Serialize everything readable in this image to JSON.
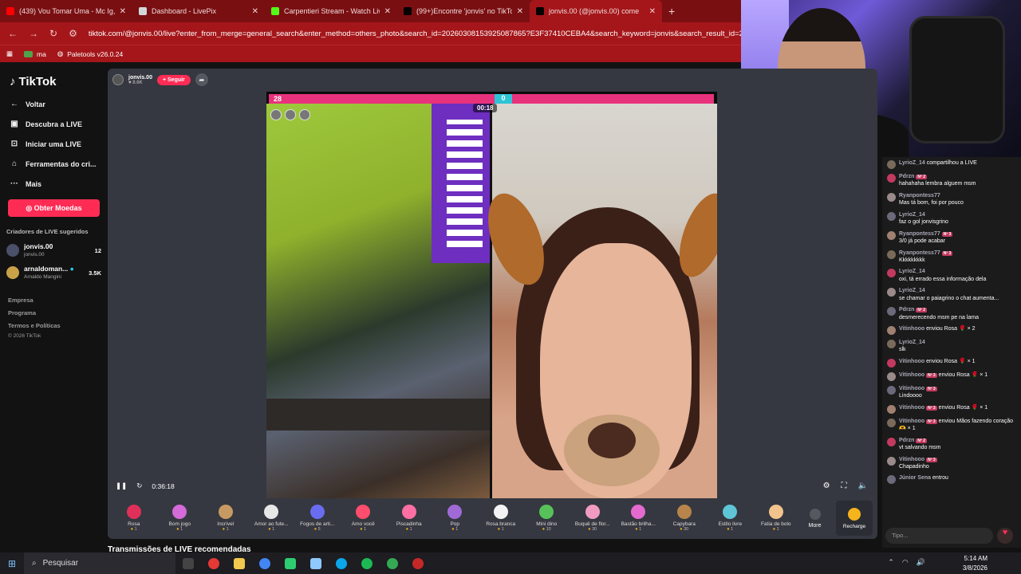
{
  "tabs": [
    {
      "title": "(439) Vou Tomar Uma - Mc Ig, M",
      "fav": "#ff0000"
    },
    {
      "title": "Dashboard - LivePix",
      "fav": "#cfd8dc"
    },
    {
      "title": "Carpentieri Stream - Watch Live",
      "fav": "#53fc18"
    },
    {
      "title": "(99+)Encontre 'jonvis' no TikTok",
      "fav": "#000000"
    },
    {
      "title": "jonvis.00 (@jonvis.00) come",
      "fav": "#000000"
    }
  ],
  "address": {
    "url": "tiktok.com/@jonvis.00/live?enter_from_merge=general_search&enter_method=others_photo&search_id=20260308153925087865?E3F37410CEBA4&search_keyword=jonvis&search_result_id=2422438"
  },
  "bookmarks": [
    "ma",
    "Paletools v26.0.24"
  ],
  "sidebar": {
    "logo": "TikTok",
    "items": [
      {
        "icon": "←",
        "label": "Voltar"
      },
      {
        "icon": "▣",
        "label": "Descubra a LIVE"
      },
      {
        "icon": "⊡",
        "label": "Iniciar uma LIVE"
      },
      {
        "icon": "⌂",
        "label": "Ferramentas do cri..."
      },
      {
        "icon": "···",
        "label": "Mais"
      }
    ],
    "coins": "Obter Moedas",
    "suggested_title": "Criadores de LIVE sugeridos",
    "creators": [
      {
        "name": "jonvis.00",
        "sub": "jonvis.00",
        "count": "12"
      },
      {
        "name": "arnaldoman...",
        "sub": "Arnaldo Mangini",
        "count": "3.5K"
      }
    ],
    "footer": [
      "Empresa",
      "Programa",
      "Termos e Políticas"
    ],
    "copyright": "© 2026 TikTok"
  },
  "player": {
    "host": "jonvis.00",
    "host_sub": "♥ 8.6K",
    "follow": "+ Seguir",
    "pk_left": "28",
    "pk_right": "0",
    "timer": "00:18",
    "elapsed": "0:36:18",
    "rec_title": "Transmissões de LIVE recomendadas"
  },
  "gifts": [
    {
      "name": "Rosa",
      "price": "1",
      "color": "#e0305a"
    },
    {
      "name": "Bom jogo",
      "price": "1",
      "color": "#d56ad9"
    },
    {
      "name": "Incrível",
      "price": "1",
      "color": "#c89a63"
    },
    {
      "name": "Amor ao fute...",
      "price": "1",
      "color": "#e7e7e7"
    },
    {
      "name": "Fogos de arti...",
      "price": "5",
      "color": "#6a6cf0"
    },
    {
      "name": "Amo você",
      "price": "1",
      "color": "#ff4d6d"
    },
    {
      "name": "Piscadinha",
      "price": "1",
      "color": "#ff6fa3"
    },
    {
      "name": "Pop",
      "price": "1",
      "color": "#a06ad6"
    },
    {
      "name": "Rosa branca",
      "price": "1",
      "color": "#f3f3f3"
    },
    {
      "name": "Mini dino",
      "price": "10",
      "color": "#58c25a"
    },
    {
      "name": "Buquê de flor...",
      "price": "30",
      "color": "#f29bc0"
    },
    {
      "name": "Bastão brilha...",
      "price": "1",
      "color": "#e46ad0"
    },
    {
      "name": "Capybara",
      "price": "30",
      "color": "#b7844b"
    },
    {
      "name": "Estilo livre",
      "price": "1",
      "color": "#5ec6d6"
    },
    {
      "name": "Fatia de bolo",
      "price": "1",
      "color": "#f2c38c"
    }
  ],
  "more": "More",
  "recharge": "Recharge",
  "chat": [
    {
      "user": "LyrioZ_14",
      "level": "",
      "text": "compartilhou a LIVE",
      "inline": true
    },
    {
      "user": "Pdrzn",
      "level": "Nº 2",
      "text": "hahahaha lembra alguem msm"
    },
    {
      "user": "Ryanpontess77",
      "level": "",
      "text": "Mas tá bom, foi por pouco"
    },
    {
      "user": "LyrioZ_14",
      "level": "",
      "text": "faz o gol jonvisgrino"
    },
    {
      "user": "Ryanpontess77",
      "level": "Nº 3",
      "text": "3/0 já pode acabar"
    },
    {
      "user": "Ryanpontess77",
      "level": "Nº 3",
      "text": "Kkkkkkkkk"
    },
    {
      "user": "LyrioZ_14",
      "level": "",
      "text": "oxi, tá errado essa informação dela"
    },
    {
      "user": "LyrioZ_14",
      "level": "",
      "text": "se chamar o paiagrino o chat aumenta..."
    },
    {
      "user": "Pdrzn",
      "level": "Nº 2",
      "text": "desmerecendo msm pe na lama"
    },
    {
      "user": "Vitinhooo",
      "level": "",
      "text": "enviou Rosa 🌹 × 2",
      "inline": true
    },
    {
      "user": "LyrioZ_14",
      "level": "",
      "text": "slk"
    },
    {
      "user": "Vitinhooo",
      "level": "",
      "text": "enviou Rosa 🌹 × 1",
      "inline": true
    },
    {
      "user": "Vitinhooo",
      "level": "Nº 3",
      "text": "enviou Rosa 🌹 × 1",
      "inline": true
    },
    {
      "user": "Vitinhooo",
      "level": "Nº 3",
      "text": "Lindoooo"
    },
    {
      "user": "Vitinhooo",
      "level": "Nº 3",
      "text": "enviou Rosa 🌹 × 1",
      "inline": true
    },
    {
      "user": "Vitinhooo",
      "level": "Nº 3",
      "text": "enviou Mãos fazendo coração 🫶 × 1",
      "inline": true
    },
    {
      "user": "Pdrzn",
      "level": "Nº 2",
      "text": "vt salvando msm"
    },
    {
      "user": "Vitinhooo",
      "level": "Nº 3",
      "text": "Chapadinho"
    },
    {
      "user": "Júnior Sena",
      "level": "",
      "text": "entrou",
      "inline": true
    }
  ],
  "chat_input": {
    "placeholder": "Tipo..."
  },
  "taskbar": {
    "search": "Pesquisar",
    "time": "5:14 AM",
    "date": "3/8/2026"
  }
}
